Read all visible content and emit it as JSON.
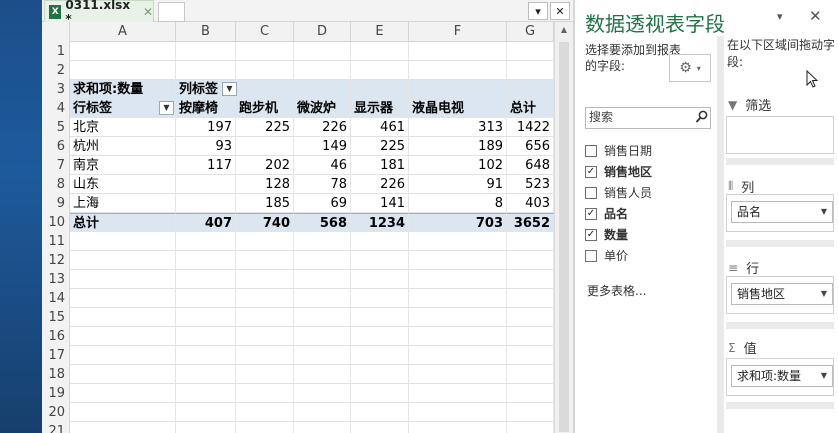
{
  "workbook": {
    "tab_icon": "X",
    "tab_name": "0311.xlsx *",
    "tab_close": "✕",
    "btn_dropdown": "▾",
    "btn_close": "✕"
  },
  "columns": [
    "A",
    "B",
    "C",
    "D",
    "E",
    "F",
    "G"
  ],
  "rows": [
    {
      "n": "1"
    },
    {
      "n": "2"
    },
    {
      "n": "3",
      "a": "求和项:数量",
      "b": "列标签"
    },
    {
      "n": "4",
      "a": "行标签",
      "b": "按摩椅",
      "c": "跑步机",
      "d": "微波炉",
      "e": "显示器",
      "f": "液晶电视",
      "g": "总计"
    },
    {
      "n": "5",
      "a": "北京",
      "b": "197",
      "c": "225",
      "d": "226",
      "e": "461",
      "f": "313",
      "g": "1422"
    },
    {
      "n": "6",
      "a": "杭州",
      "b": "93",
      "c": "",
      "d": "149",
      "e": "225",
      "f": "189",
      "g": "656"
    },
    {
      "n": "7",
      "a": "南京",
      "b": "117",
      "c": "202",
      "d": "46",
      "e": "181",
      "f": "102",
      "g": "648"
    },
    {
      "n": "8",
      "a": "山东",
      "b": "",
      "c": "128",
      "d": "78",
      "e": "226",
      "f": "91",
      "g": "523"
    },
    {
      "n": "9",
      "a": "上海",
      "b": "",
      "c": "185",
      "d": "69",
      "e": "141",
      "f": "8",
      "g": "403"
    },
    {
      "n": "10",
      "a": "总计",
      "b": "407",
      "c": "740",
      "d": "568",
      "e": "1234",
      "f": "703",
      "g": "3652"
    },
    {
      "n": "11"
    },
    {
      "n": "12"
    },
    {
      "n": "13"
    },
    {
      "n": "14"
    },
    {
      "n": "15"
    },
    {
      "n": "16"
    },
    {
      "n": "17"
    },
    {
      "n": "18"
    },
    {
      "n": "19"
    },
    {
      "n": "20"
    },
    {
      "n": "21"
    }
  ],
  "pane": {
    "title": "数据透视表字段",
    "options_caret": "▾",
    "close": "✕",
    "choose_label": "选择要添加到报表的字段:",
    "gear": "⚙",
    "gear_caret": "▾",
    "search_placeholder": "搜索",
    "fields": [
      {
        "label": "销售日期",
        "checked": false
      },
      {
        "label": "销售地区",
        "checked": true
      },
      {
        "label": "销售人员",
        "checked": false
      },
      {
        "label": "品名",
        "checked": true
      },
      {
        "label": "数量",
        "checked": true
      },
      {
        "label": "单价",
        "checked": false
      }
    ],
    "more_tables": "更多表格...",
    "drag_hint": "在以下区域间拖动字段:",
    "filter_label": "筛选",
    "columns_label": "列",
    "columns_value": "品名",
    "rows_label": "行",
    "rows_value": "销售地区",
    "values_label": "值",
    "values_value": "求和项:数量",
    "check_mark": "✓"
  }
}
